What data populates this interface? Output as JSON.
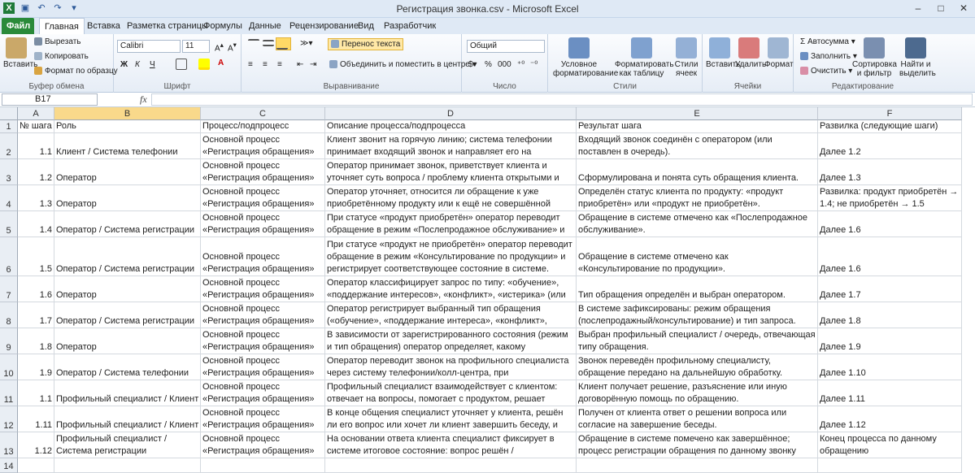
{
  "window": {
    "title": "Регистрация звонка.csv  -  Microsoft Excel"
  },
  "tabs": [
    "Файл",
    "Главная",
    "Вставка",
    "Разметка страницы",
    "Формулы",
    "Данные",
    "Рецензирование",
    "Вид",
    "Разработчик"
  ],
  "ribbon": {
    "clipboard": {
      "paste": "Вставить",
      "cut": "Вырезать",
      "copy": "Копировать",
      "format_painter": "Формат по образцу",
      "label": "Буфер обмена"
    },
    "font": {
      "name": "Calibri",
      "size": "11",
      "bold": "Ж",
      "italic": "К",
      "underline": "Ч",
      "label": "Шрифт"
    },
    "alignment": {
      "wrap": "Перенос текста",
      "merge": "Объединить и поместить в центре",
      "label": "Выравнивание"
    },
    "number": {
      "format": "Общий",
      "label": "Число"
    },
    "styles": {
      "conditional": "Условное форматирование",
      "as_table": "Форматировать как таблицу",
      "cell_styles": "Стили ячеек",
      "label": "Стили"
    },
    "cells": {
      "insert": "Вставить",
      "delete": "Удалить",
      "format": "Формат",
      "label": "Ячейки"
    },
    "editing": {
      "autosum": "Автосумма",
      "fill": "Заполнить",
      "clear": "Очистить",
      "sort": "Сортировка и фильтр",
      "find": "Найти и выделить",
      "label": "Редактирование"
    }
  },
  "formula_bar": {
    "name_box": "B17",
    "fx": "fx",
    "value": ""
  },
  "columns": [
    "A",
    "B",
    "C",
    "D",
    "E",
    "F"
  ],
  "rows": [
    {
      "n": "1",
      "a": "№ шага",
      "b": [
        "Роль"
      ],
      "c": [
        "Процесс/подпроцесс"
      ],
      "d": [
        "Описание процесса/подпроцесса"
      ],
      "e": [
        "Результат шага"
      ],
      "f": [
        "Развилка (следующие шаги)"
      ]
    },
    {
      "n": "2",
      "a": "1.1",
      "b": [
        "Клиент / Система телефонии"
      ],
      "c": [
        "Основной процесс",
        "«Регистрация обращения»"
      ],
      "d": [
        "Клиент звонит на горячую линию; система телефонии",
        "принимает входящий звонок и направляет его на"
      ],
      "e": [
        "Входящий звонок соединён с оператором (или",
        "поставлен в очередь)."
      ],
      "f": [
        "Далее 1.2"
      ]
    },
    {
      "n": "3",
      "a": "1.2",
      "b": [
        "Оператор"
      ],
      "c": [
        "Основной процесс",
        "«Регистрация обращения»"
      ],
      "d": [
        "Оператор принимает звонок, приветствует клиента и",
        "уточняет суть вопроса / проблему клиента открытыми и"
      ],
      "e": [
        "Сформулирована и понята суть обращения клиента."
      ],
      "f": [
        "Далее 1.3"
      ]
    },
    {
      "n": "4",
      "a": "1.3",
      "b": [
        "Оператор"
      ],
      "c": [
        "Основной процесс",
        "«Регистрация обращения»"
      ],
      "d": [
        "Оператор уточняет, относится ли обращение к уже",
        "приобретённому продукту или к ещё не совершённой"
      ],
      "e": [
        "Определён статус клиента по продукту: «продукт",
        "приобретён» или «продукт не приобретён»."
      ],
      "f": [
        "Развилка: продукт приобретён →",
        "1.4; не приобретён → 1.5"
      ]
    },
    {
      "n": "5",
      "a": "1.4",
      "b": [
        "Оператор / Система регистрации"
      ],
      "c": [
        "Основной процесс",
        "«Регистрация обращения»"
      ],
      "d": [
        "При статусе «продукт приобретён» оператор переводит",
        "обращение в режим «Послепродажное обслуживание» и"
      ],
      "e": [
        "Обращение в системе отмечено как «Послепродажное",
        "обслуживание»."
      ],
      "f": [
        "Далее 1.6"
      ]
    },
    {
      "n": "6",
      "a": "1.5",
      "b": [
        "Оператор / Система регистрации"
      ],
      "c": [
        "Основной процесс",
        "«Регистрация обращения»"
      ],
      "d": [
        "При статусе «продукт не приобретён» оператор переводит",
        "обращение в режим «Консультирование по продукции» и",
        "регистрирует соответствующее состояние в системе."
      ],
      "e": [
        "Обращение в системе отмечено как",
        "«Консультирование по продукции»."
      ],
      "f": [
        "Далее 1.6"
      ]
    },
    {
      "n": "7",
      "a": "1.6",
      "b": [
        "Оператор"
      ],
      "c": [
        "Основной процесс",
        "«Регистрация обращения»"
      ],
      "d": [
        "Оператор классифицирует запрос по типу: «обучение»,",
        "«поддержание интересов», «конфликт», «истерика» (или"
      ],
      "e": [
        "Тип обращения определён и выбран оператором."
      ],
      "f": [
        "Далее 1.7"
      ]
    },
    {
      "n": "8",
      "a": "1.7",
      "b": [
        "Оператор / Система регистрации"
      ],
      "c": [
        "Основной процесс",
        "«Регистрация обращения»"
      ],
      "d": [
        "Оператор регистрирует выбранный тип обращения",
        "(«обучение», «поддержание интереса», «конфликт»,"
      ],
      "e": [
        "В системе зафиксированы: режим обращения",
        "(послепродажный/консультирование) и тип запроса."
      ],
      "f": [
        "Далее 1.8"
      ]
    },
    {
      "n": "9",
      "a": "1.8",
      "b": [
        "Оператор"
      ],
      "c": [
        "Основной процесс",
        "«Регистрация обращения»"
      ],
      "d": [
        "В зависимости от зарегистрированного состояния (режим",
        "и тип обращения) оператор определяет, какому"
      ],
      "e": [
        "Выбран профильный специалист / очередь, отвечающая",
        "типу обращения."
      ],
      "f": [
        "Далее 1.9"
      ]
    },
    {
      "n": "10",
      "a": "1.9",
      "b": [
        "Оператор / Система телефонии"
      ],
      "c": [
        "Основной процесс",
        "«Регистрация обращения»"
      ],
      "d": [
        "Оператор переводит звонок на профильного специалиста",
        "через систему телефонии/колл-центра, при"
      ],
      "e": [
        "Звонок переведён профильному специалисту,",
        "обращение передано на дальнейшую обработку."
      ],
      "f": [
        "Далее 1.10"
      ]
    },
    {
      "n": "11",
      "a": "1.1",
      "b": [
        "Профильный специалист / Клиент"
      ],
      "c": [
        "Основной процесс",
        "«Регистрация обращения»"
      ],
      "d": [
        "Профильный специалист взаимодействует с клиентом:",
        "отвечает на вопросы, помогает с продуктом, решает"
      ],
      "e": [
        "Клиент получает решение, разъяснение или иную",
        "договорённую помощь по обращению."
      ],
      "f": [
        "Далее 1.11"
      ]
    },
    {
      "n": "12",
      "a": "1.11",
      "b": [
        "Профильный специалист / Клиент"
      ],
      "c": [
        "Основной процесс",
        "«Регистрация обращения»"
      ],
      "d": [
        "В конце общения специалист уточняет у клиента, решён",
        "ли его вопрос или хочет ли клиент завершить беседу, и"
      ],
      "e": [
        "Получен от клиента ответ о решении вопроса или",
        "согласие на завершение беседы."
      ],
      "f": [
        "Далее 1.12"
      ]
    },
    {
      "n": "13",
      "a": "1.12",
      "b": [
        "Профильный специалист /",
        "Система регистрации"
      ],
      "c": [
        "Основной процесс",
        "«Регистрация обращения»"
      ],
      "d": [
        "На основании ответа клиента специалист фиксирует в",
        "системе итоговое состояние: вопрос решён /"
      ],
      "e": [
        "Обращение в системе помечено как завершённое;",
        "процесс регистрации обращения по данному звонку"
      ],
      "f": [
        "Конец процесса по данному",
        "обращению"
      ]
    },
    {
      "n": "14",
      "a": "",
      "b": [
        ""
      ],
      "c": [
        ""
      ],
      "d": [
        ""
      ],
      "e": [
        ""
      ],
      "f": [
        ""
      ]
    }
  ]
}
